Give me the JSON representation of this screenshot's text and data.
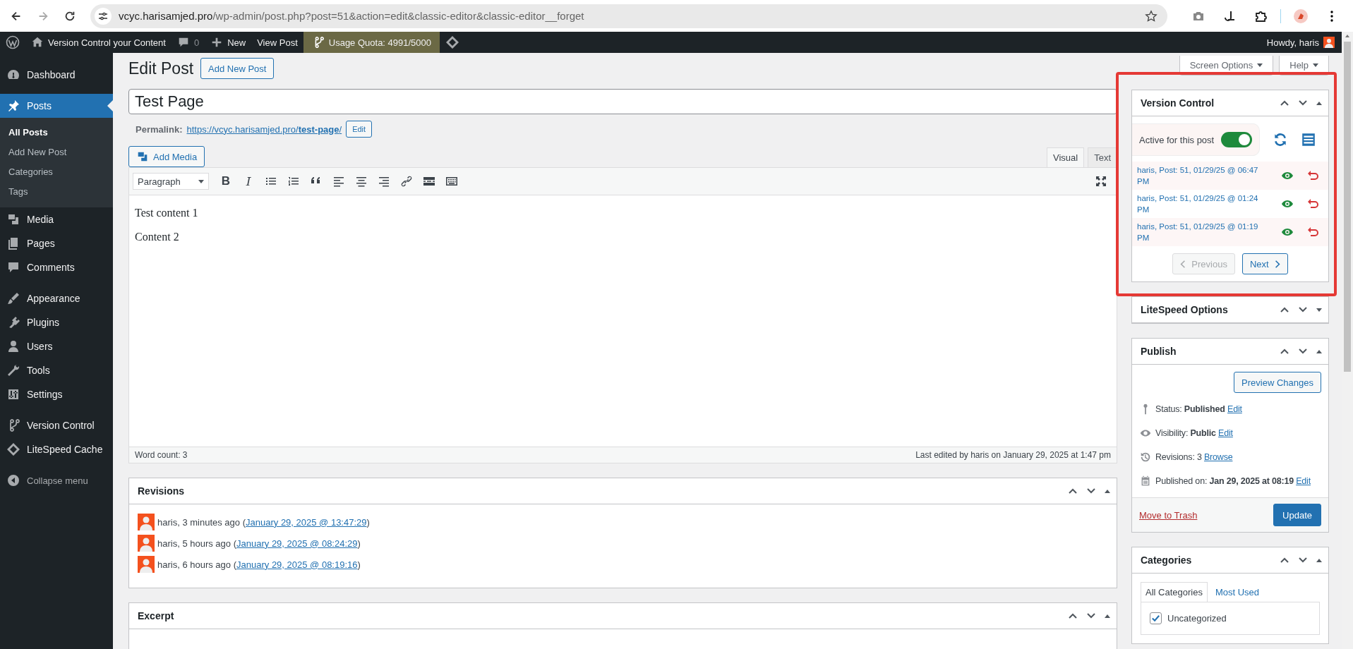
{
  "browser": {
    "url_host": "vcyc.harisamjed.pro",
    "url_path": "/wp-admin/post.php?post=51&action=edit&classic-editor&classic-editor__forget"
  },
  "admin_bar": {
    "items": [
      {
        "kind": "site",
        "label": "Version Control your Content"
      },
      {
        "kind": "comments",
        "label": "0"
      },
      {
        "kind": "new",
        "label": "New"
      },
      {
        "kind": "view",
        "label": "View Post"
      },
      {
        "kind": "quota",
        "label": "Usage Quota: 4991/5000"
      },
      {
        "kind": "cache"
      }
    ],
    "howdy": "Howdy, haris"
  },
  "sidebar": {
    "groups": [
      [
        {
          "label": "Dashboard",
          "selected": false
        }
      ],
      [
        {
          "label": "Posts",
          "selected": true,
          "children": [
            {
              "label": "All Posts",
              "selected": true
            },
            {
              "label": "Add New Post",
              "selected": false
            },
            {
              "label": "Categories",
              "selected": false
            },
            {
              "label": "Tags",
              "selected": false
            }
          ]
        },
        {
          "label": "Media",
          "selected": false
        },
        {
          "label": "Pages",
          "selected": false
        },
        {
          "label": "Comments",
          "selected": false
        }
      ],
      [
        {
          "label": "Appearance",
          "selected": false
        },
        {
          "label": "Plugins",
          "selected": false
        },
        {
          "label": "Users",
          "selected": false
        },
        {
          "label": "Tools",
          "selected": false
        },
        {
          "label": "Settings",
          "selected": false
        }
      ],
      [
        {
          "label": "Version Control",
          "selected": false
        },
        {
          "label": "LiteSpeed Cache",
          "selected": false
        }
      ]
    ],
    "collapse": "Collapse menu"
  },
  "header": {
    "title": "Edit Post",
    "add_new": "Add New Post",
    "screen_options": "Screen Options",
    "help": "Help"
  },
  "post": {
    "title": "Test Page",
    "permalink_label": "Permalink:",
    "permalink": "https://vcyc.harisamjed.pro/**test-page**/",
    "permalink_edit": "Edit"
  },
  "editor": {
    "add_media": "Add Media",
    "tabs": [
      {
        "label": "Visual",
        "selected": true
      },
      {
        "label": "Text",
        "selected": false
      }
    ],
    "format": "Paragraph",
    "tools": [
      {
        "kind": "bold",
        "glyph": "B"
      },
      {
        "kind": "italic",
        "glyph": "I"
      },
      {
        "kind": "bullet-list"
      },
      {
        "kind": "number-list"
      },
      {
        "kind": "quote"
      },
      {
        "kind": "align-left"
      },
      {
        "kind": "align-center"
      },
      {
        "kind": "align-right"
      },
      {
        "kind": "link"
      },
      {
        "kind": "read-more"
      },
      {
        "kind": "toolbar-toggle"
      }
    ],
    "content": [
      "Test content 1",
      "Content 2"
    ],
    "word_count": "Word count: 3",
    "last_edited": "Last edited by haris on January 29, 2025 at 1:47 pm"
  },
  "revisions": {
    "title": "Revisions",
    "expanded": true,
    "rows": [
      {
        "prefix": "haris, 3 minutes ago (",
        "link": "January 29, 2025 @ 13:47:29",
        "suffix": ")"
      },
      {
        "prefix": "haris, 5 hours ago (",
        "link": "January 29, 2025 @ 08:24:29",
        "suffix": ")"
      },
      {
        "prefix": "haris, 6 hours ago (",
        "link": "January 29, 2025 @ 08:19:16",
        "suffix": ")"
      }
    ]
  },
  "excerpt": {
    "title": "Excerpt",
    "expanded": true
  },
  "version_control": {
    "title": "Version Control",
    "expanded": true,
    "active_label": "Active for this post",
    "active": true,
    "versions": [
      "haris, Post: 51, 01/29/25 @ 06:47 PM",
      "haris, Post: 51, 01/29/25 @ 01:24 PM",
      "haris, Post: 51, 01/29/25 @ 01:19 PM"
    ],
    "previous": {
      "label": "Previous",
      "disabled": true
    },
    "next": {
      "label": "Next",
      "disabled": false
    }
  },
  "litespeed": {
    "title": "LiteSpeed Options",
    "expanded": false
  },
  "publish": {
    "title": "Publish",
    "expanded": true,
    "preview": "Preview Changes",
    "rows": [
      {
        "text": "Status: **Published**",
        "link": "Edit"
      },
      {
        "text": "Visibility: **Public**",
        "link": "Edit"
      },
      {
        "text": "Revisions: 3",
        "link": "Browse"
      },
      {
        "text": "Published on: **Jan 29, 2025 at 08:19**",
        "link": "Edit"
      }
    ],
    "trash": "Move to Trash",
    "update": "Update"
  },
  "categories": {
    "title": "Categories",
    "expanded": true,
    "tabs": [
      {
        "label": "All Categories",
        "selected": true
      },
      {
        "label": "Most Used",
        "selected": false
      }
    ],
    "items": [
      {
        "label": "Uncategorized",
        "checked": true
      }
    ]
  }
}
